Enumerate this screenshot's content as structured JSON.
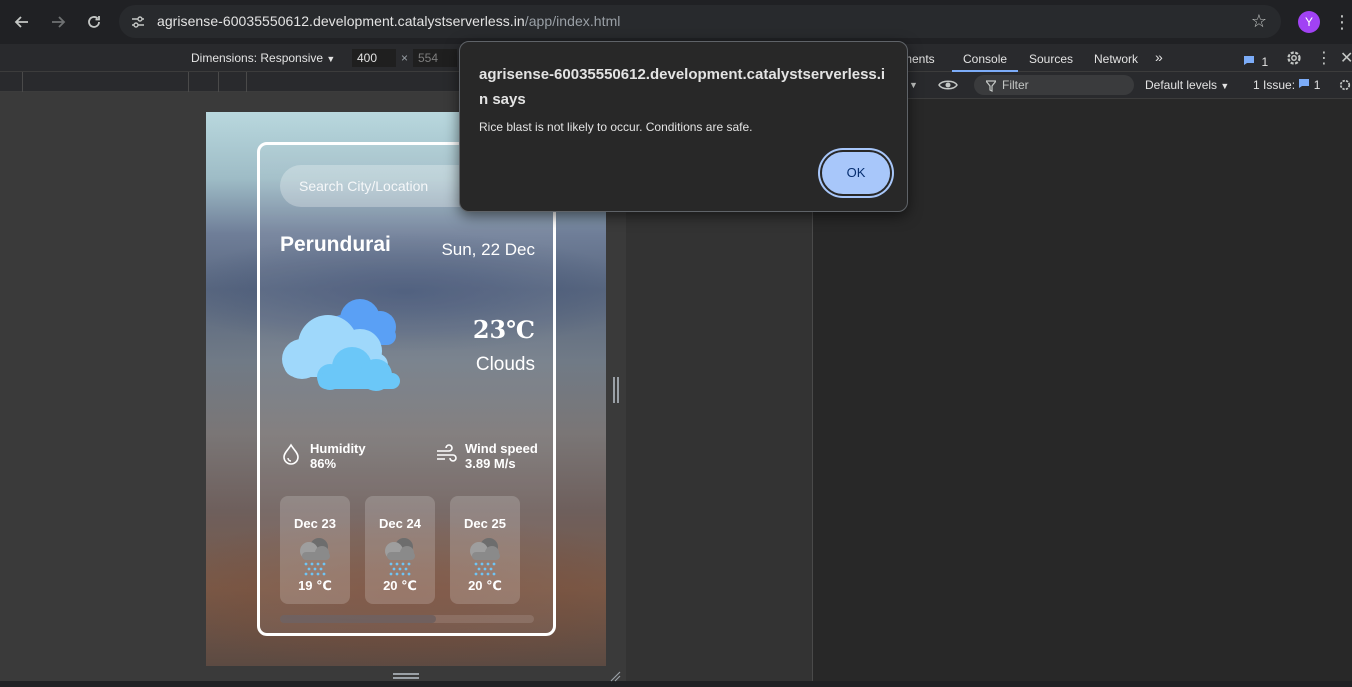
{
  "browser": {
    "url_host": "agrisense-60035550612.development.catalystserverless.in",
    "url_path": "/app/index.html",
    "avatar_letter": "Y",
    "avatar_color": "#a142f4"
  },
  "device_toolbar": {
    "dimensions_label": "Dimensions: Responsive",
    "width": "400",
    "separator": "×",
    "height": "554"
  },
  "devtools": {
    "tabs": [
      "ments",
      "Console",
      "Sources",
      "Network"
    ],
    "active_tab": "Console",
    "issues_badge": "1",
    "filter_placeholder": "Filter",
    "levels": "Default levels",
    "issues_label": "1 Issue:",
    "issues_count": "1"
  },
  "dialog": {
    "title": "agrisense-60035550612.development.catalystserverless.in says",
    "message": "Rice blast is not likely to occur. Conditions are safe.",
    "ok_label": "OK"
  },
  "weather": {
    "search_placeholder": "Search City/Location",
    "city": "Perundurai",
    "date": "Sun, 22 Dec",
    "temperature": "23℃",
    "condition": "Clouds",
    "humidity_label": "Humidity",
    "humidity_value": "86%",
    "wind_label": "Wind speed",
    "wind_value": "3.89 M/s",
    "forecast": [
      {
        "date": "Dec 23",
        "temp": "19 ℃",
        "icon": "rain-cloud-icon"
      },
      {
        "date": "Dec 24",
        "temp": "20 ℃",
        "icon": "rain-cloud-icon"
      },
      {
        "date": "Dec 25",
        "temp": "20 ℃",
        "icon": "rain-cloud-icon"
      }
    ]
  }
}
